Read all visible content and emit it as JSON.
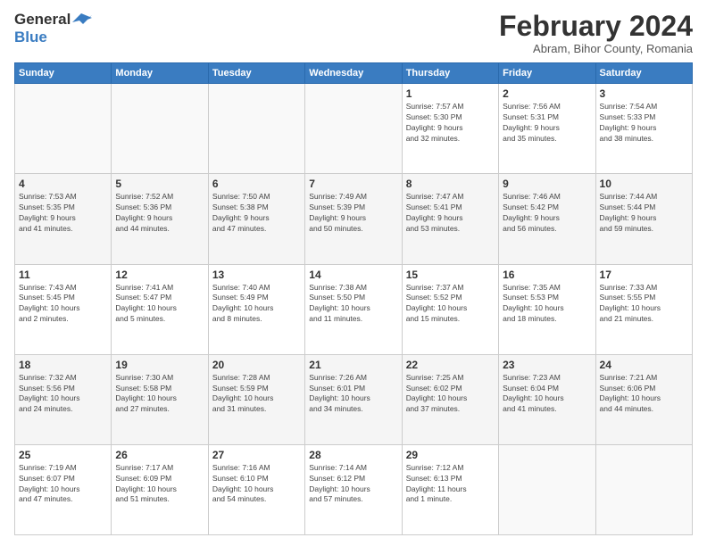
{
  "logo": {
    "line1": "General",
    "line2": "Blue"
  },
  "title": "February 2024",
  "subtitle": "Abram, Bihor County, Romania",
  "days_header": [
    "Sunday",
    "Monday",
    "Tuesday",
    "Wednesday",
    "Thursday",
    "Friday",
    "Saturday"
  ],
  "weeks": [
    [
      {
        "day": "",
        "info": ""
      },
      {
        "day": "",
        "info": ""
      },
      {
        "day": "",
        "info": ""
      },
      {
        "day": "",
        "info": ""
      },
      {
        "day": "1",
        "info": "Sunrise: 7:57 AM\nSunset: 5:30 PM\nDaylight: 9 hours\nand 32 minutes."
      },
      {
        "day": "2",
        "info": "Sunrise: 7:56 AM\nSunset: 5:31 PM\nDaylight: 9 hours\nand 35 minutes."
      },
      {
        "day": "3",
        "info": "Sunrise: 7:54 AM\nSunset: 5:33 PM\nDaylight: 9 hours\nand 38 minutes."
      }
    ],
    [
      {
        "day": "4",
        "info": "Sunrise: 7:53 AM\nSunset: 5:35 PM\nDaylight: 9 hours\nand 41 minutes."
      },
      {
        "day": "5",
        "info": "Sunrise: 7:52 AM\nSunset: 5:36 PM\nDaylight: 9 hours\nand 44 minutes."
      },
      {
        "day": "6",
        "info": "Sunrise: 7:50 AM\nSunset: 5:38 PM\nDaylight: 9 hours\nand 47 minutes."
      },
      {
        "day": "7",
        "info": "Sunrise: 7:49 AM\nSunset: 5:39 PM\nDaylight: 9 hours\nand 50 minutes."
      },
      {
        "day": "8",
        "info": "Sunrise: 7:47 AM\nSunset: 5:41 PM\nDaylight: 9 hours\nand 53 minutes."
      },
      {
        "day": "9",
        "info": "Sunrise: 7:46 AM\nSunset: 5:42 PM\nDaylight: 9 hours\nand 56 minutes."
      },
      {
        "day": "10",
        "info": "Sunrise: 7:44 AM\nSunset: 5:44 PM\nDaylight: 9 hours\nand 59 minutes."
      }
    ],
    [
      {
        "day": "11",
        "info": "Sunrise: 7:43 AM\nSunset: 5:45 PM\nDaylight: 10 hours\nand 2 minutes."
      },
      {
        "day": "12",
        "info": "Sunrise: 7:41 AM\nSunset: 5:47 PM\nDaylight: 10 hours\nand 5 minutes."
      },
      {
        "day": "13",
        "info": "Sunrise: 7:40 AM\nSunset: 5:49 PM\nDaylight: 10 hours\nand 8 minutes."
      },
      {
        "day": "14",
        "info": "Sunrise: 7:38 AM\nSunset: 5:50 PM\nDaylight: 10 hours\nand 11 minutes."
      },
      {
        "day": "15",
        "info": "Sunrise: 7:37 AM\nSunset: 5:52 PM\nDaylight: 10 hours\nand 15 minutes."
      },
      {
        "day": "16",
        "info": "Sunrise: 7:35 AM\nSunset: 5:53 PM\nDaylight: 10 hours\nand 18 minutes."
      },
      {
        "day": "17",
        "info": "Sunrise: 7:33 AM\nSunset: 5:55 PM\nDaylight: 10 hours\nand 21 minutes."
      }
    ],
    [
      {
        "day": "18",
        "info": "Sunrise: 7:32 AM\nSunset: 5:56 PM\nDaylight: 10 hours\nand 24 minutes."
      },
      {
        "day": "19",
        "info": "Sunrise: 7:30 AM\nSunset: 5:58 PM\nDaylight: 10 hours\nand 27 minutes."
      },
      {
        "day": "20",
        "info": "Sunrise: 7:28 AM\nSunset: 5:59 PM\nDaylight: 10 hours\nand 31 minutes."
      },
      {
        "day": "21",
        "info": "Sunrise: 7:26 AM\nSunset: 6:01 PM\nDaylight: 10 hours\nand 34 minutes."
      },
      {
        "day": "22",
        "info": "Sunrise: 7:25 AM\nSunset: 6:02 PM\nDaylight: 10 hours\nand 37 minutes."
      },
      {
        "day": "23",
        "info": "Sunrise: 7:23 AM\nSunset: 6:04 PM\nDaylight: 10 hours\nand 41 minutes."
      },
      {
        "day": "24",
        "info": "Sunrise: 7:21 AM\nSunset: 6:06 PM\nDaylight: 10 hours\nand 44 minutes."
      }
    ],
    [
      {
        "day": "25",
        "info": "Sunrise: 7:19 AM\nSunset: 6:07 PM\nDaylight: 10 hours\nand 47 minutes."
      },
      {
        "day": "26",
        "info": "Sunrise: 7:17 AM\nSunset: 6:09 PM\nDaylight: 10 hours\nand 51 minutes."
      },
      {
        "day": "27",
        "info": "Sunrise: 7:16 AM\nSunset: 6:10 PM\nDaylight: 10 hours\nand 54 minutes."
      },
      {
        "day": "28",
        "info": "Sunrise: 7:14 AM\nSunset: 6:12 PM\nDaylight: 10 hours\nand 57 minutes."
      },
      {
        "day": "29",
        "info": "Sunrise: 7:12 AM\nSunset: 6:13 PM\nDaylight: 11 hours\nand 1 minute."
      },
      {
        "day": "",
        "info": ""
      },
      {
        "day": "",
        "info": ""
      }
    ]
  ]
}
